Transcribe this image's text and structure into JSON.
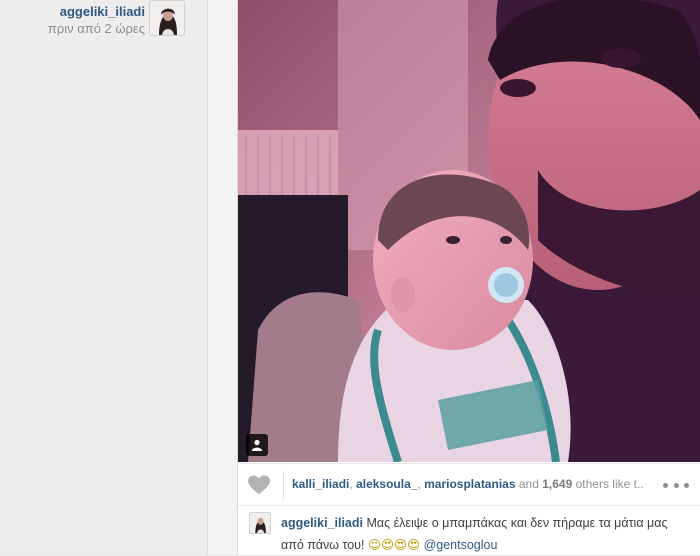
{
  "post": {
    "author": "aggeliki_iliadi",
    "timestamp": "πριν από 2 ώρες"
  },
  "likes": {
    "users": [
      "kalli_iliadi",
      "aleksoula_",
      "mariosplatanias"
    ],
    "sep": ",",
    "and1": "and",
    "count": "1,649",
    "tail": "others like t..."
  },
  "caption": {
    "author": "aggeliki_iliadi",
    "text": "Μας έλειψε ο μπαμπάκας και δεν πήραμε τα μάτια μας από πάνω του!",
    "emoji": "☺😍😍😍",
    "mention": "@gentsoglou"
  },
  "icons": {
    "like": "heart-icon",
    "more": "more-options-icon",
    "tag": "user-tag-icon"
  }
}
